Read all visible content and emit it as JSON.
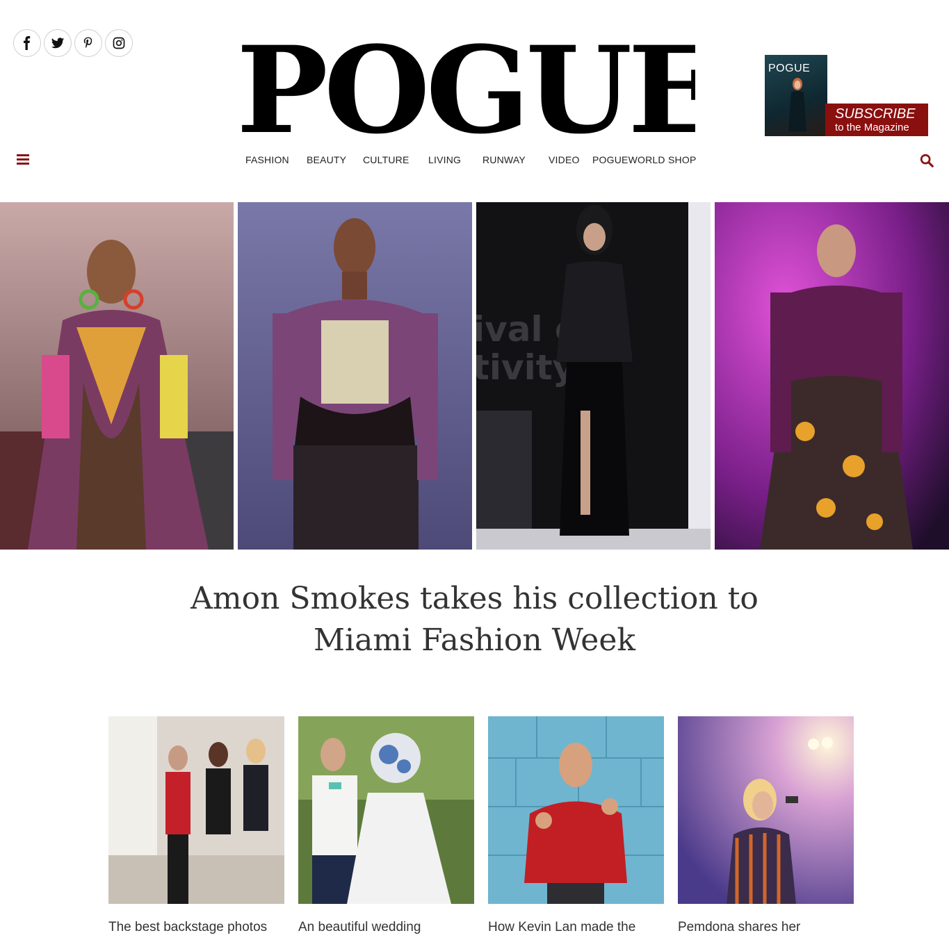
{
  "brand": {
    "logo": "POGUE",
    "accent_color": "#8a0f0f"
  },
  "social": [
    {
      "name": "facebook-icon",
      "glyph": "f"
    },
    {
      "name": "twitter-icon",
      "glyph": "t"
    },
    {
      "name": "pinterest-icon",
      "glyph": "p"
    },
    {
      "name": "instagram-icon",
      "glyph": "i"
    }
  ],
  "subscribe": {
    "cover_title": "POGUE",
    "line1": "SUBSCRIBE",
    "line2": "to the Magazine"
  },
  "nav": {
    "items": [
      "FASHION",
      "BEAUTY",
      "CULTURE",
      "LIVING",
      "RUNWAY",
      "VIDEO",
      "POGUEWORLD",
      "SHOP"
    ]
  },
  "hero": {
    "photos": [
      "runway-photo-1",
      "runway-photo-2",
      "runway-photo-3",
      "runway-photo-4"
    ]
  },
  "headline": "Amon Smokes takes his collection to Miami Fashion Week",
  "cards": [
    {
      "caption": "The best backstage photos"
    },
    {
      "caption": "An beautiful wedding"
    },
    {
      "caption": "How Kevin Lan made the"
    },
    {
      "caption": "Pemdona shares her"
    }
  ]
}
